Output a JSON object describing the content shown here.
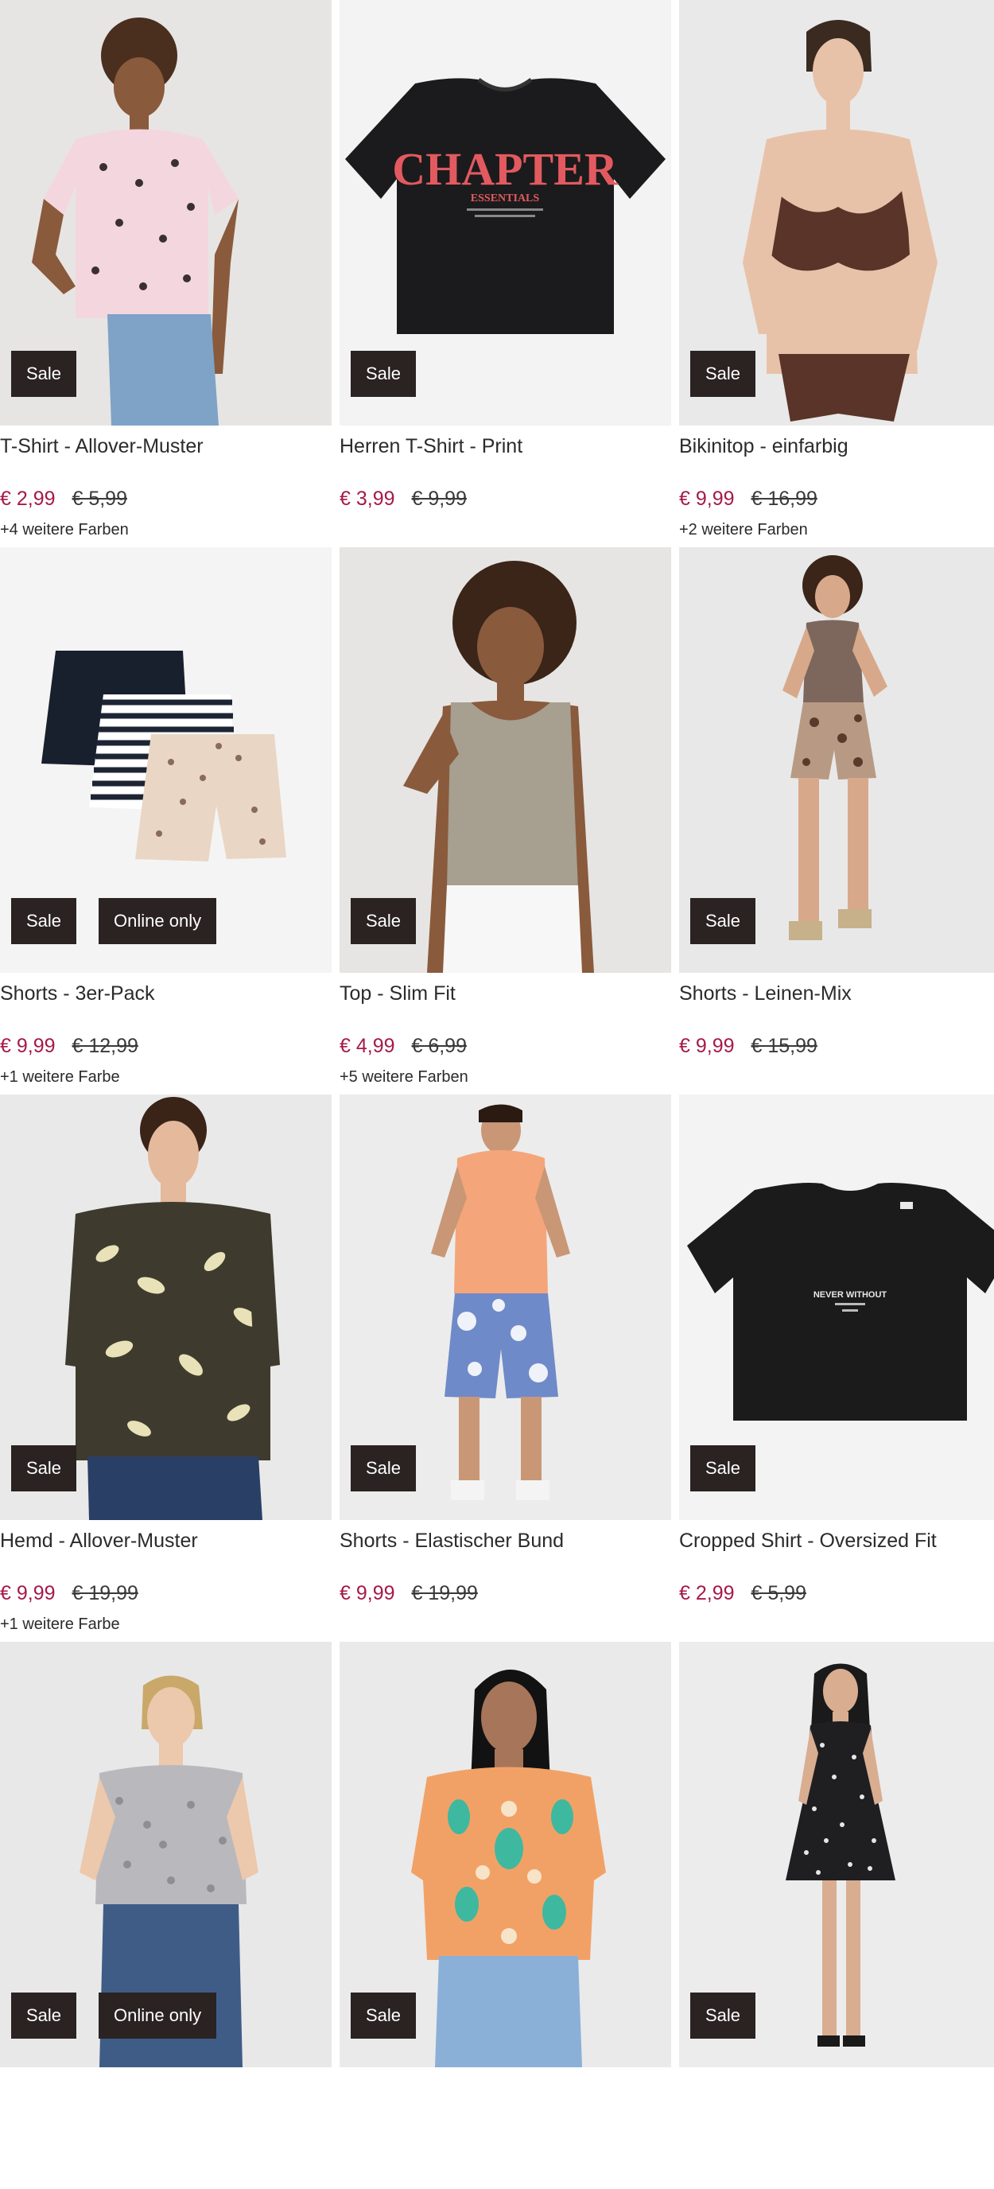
{
  "products": [
    {
      "title": "T-Shirt - Allover-Muster",
      "price": "€ 2,99",
      "old_price": "€ 5,99",
      "colors": "+4 weitere Farben",
      "badges": [
        "Sale"
      ],
      "image": "woman-pink-butterfly-tshirt",
      "bg": "#e7e6e4"
    },
    {
      "title": "Herren T-Shirt - Print",
      "price": "€ 3,99",
      "old_price": "€ 9,99",
      "colors": "",
      "badges": [
        "Sale"
      ],
      "image": "black-tshirt-chapter-print",
      "bg": "#f3f3f3"
    },
    {
      "title": "Bikinitop - einfarbig",
      "price": "€ 9,99",
      "old_price": "€ 16,99",
      "colors": "+2 weitere Farben",
      "badges": [
        "Sale"
      ],
      "image": "woman-brown-bikini",
      "bg": "#e9e9e9"
    },
    {
      "title": "Shorts - 3er-Pack",
      "price": "€ 9,99",
      "old_price": "€ 12,99",
      "colors": "+1 weitere Farbe",
      "badges": [
        "Sale",
        "Online only"
      ],
      "image": "three-shorts-pack",
      "bg": "#f4f4f4"
    },
    {
      "title": "Top - Slim Fit",
      "price": "€ 4,99",
      "old_price": "€ 6,99",
      "colors": "+5 weitere Farben",
      "badges": [
        "Sale"
      ],
      "image": "woman-beige-tank-top",
      "bg": "#e6e5e3"
    },
    {
      "title": "Shorts - Leinen-Mix",
      "price": "€ 9,99",
      "old_price": "€ 15,99",
      "colors": "",
      "badges": [
        "Sale"
      ],
      "image": "woman-paisley-shorts",
      "bg": "#e8e8e8"
    },
    {
      "title": "Hemd - Allover-Muster",
      "price": "€ 9,99",
      "old_price": "€ 19,99",
      "colors": "+1 weitere Farbe",
      "badges": [
        "Sale"
      ],
      "image": "man-leaf-print-shirt",
      "bg": "#e9e9e9"
    },
    {
      "title": "Shorts - Elastischer Bund",
      "price": "€ 9,99",
      "old_price": "€ 19,99",
      "colors": "",
      "badges": [
        "Sale"
      ],
      "image": "man-tie-dye-shorts",
      "bg": "#ececec"
    },
    {
      "title": "Cropped Shirt - Oversized Fit",
      "price": "€ 2,99",
      "old_price": "€ 5,99",
      "colors": "",
      "badges": [
        "Sale"
      ],
      "image": "black-cropped-tshirt",
      "bg": "#f3f3f3"
    },
    {
      "title": "",
      "price": "",
      "old_price": "",
      "colors": "",
      "badges": [
        "Sale",
        "Online only"
      ],
      "image": "woman-grey-floral-tshirt",
      "bg": "#e8e8e8"
    },
    {
      "title": "",
      "price": "",
      "old_price": "",
      "colors": "",
      "badges": [
        "Sale"
      ],
      "image": "woman-orange-paisley-shirt",
      "bg": "#eaeaea"
    },
    {
      "title": "",
      "price": "",
      "old_price": "",
      "colors": "",
      "badges": [
        "Sale"
      ],
      "image": "woman-black-floral-dress",
      "bg": "#ececec"
    }
  ],
  "print_text": {
    "chapter": "CHAPTER",
    "essentials": "ESSENTIALS",
    "cropped": "NEVER WITHOUT"
  }
}
